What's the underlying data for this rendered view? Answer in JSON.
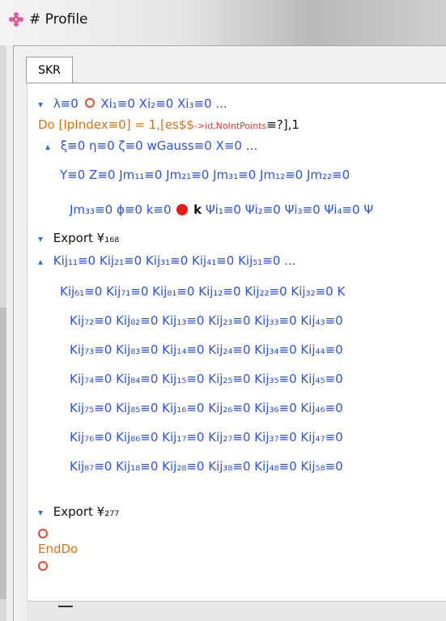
{
  "window": {
    "title": "# Profile"
  },
  "tab": {
    "label": "SKR"
  },
  "lines": [
    "λ≡0",
    "Xi₁≡0 Xi₂≡0 Xi₃≡0 ...",
    "Do [IpIndex≡0] = 1,[es$$",
    "->id,NoIntPoints",
    "≡?],1",
    "ξ≡0 η≡0 ζ≡0 wGauss≡0 X≡0 ...",
    "Y≡0 Z≡0 Jm₁₁≡0 Jm₂₁≡0 Jm₃₁≡0 Jm₁₂≡0 Jm₂₂≡0",
    "Jm₃₃≡0 ϕ≡0 k≡0",
    "k",
    "Ψi₁≡0 Ψi₂≡0 Ψi₃≡0 Ψi₄≡0 Ψ",
    "Export ¥₁₆₈",
    "Kij₁₁≡0 Kij₂₁≡0 Kij₃₁≡0 Kij₄₁≡0 Kij₅₁≡0 ...",
    "Kij₆₁≡0 Kij₇₁≡0 Kij₈₁≡0 Kij₁₂≡0 Kij₂₂≡0 Kij₃₂≡0 K",
    "Kij₇₂≡0 Kij₈₂≡0 Kij₁₃≡0 Kij₂₃≡0 Kij₃₃≡0 Kij₄₃≡0",
    "Kij₇₃≡0 Kij₈₃≡0 Kij₁₄≡0 Kij₂₄≡0 Kij₃₄≡0 Kij₄₄≡0",
    "Kij₇₄≡0 Kij₈₄≡0 Kij₁₅≡0 Kij₂₅≡0 Kij₃₅≡0 Kij₄₅≡0",
    "Kij₇₅≡0 Kij₈₅≡0 Kij₁₆≡0 Kij₂₆≡0 Kij₃₆≡0 Kij₄₆≡0",
    "Kij₇₆≡0 Kij₈₆≡0 Kij₁₇≡0 Kij₂₇≡0 Kij₃₇≡0 Kij₄₇≡0",
    "Kij₈₇≡0 Kij₁₈≡0 Kij₂₈≡0 Kij₃₈≡0 Kij₄₈≡0 Kij₅₈≡0",
    "Export ¥₂₇₇",
    "EndDo"
  ],
  "colors": {
    "variable": "#2d52e0",
    "keyword": "#e0710f",
    "string": "#e53a2a",
    "marker": "#e8191a"
  }
}
